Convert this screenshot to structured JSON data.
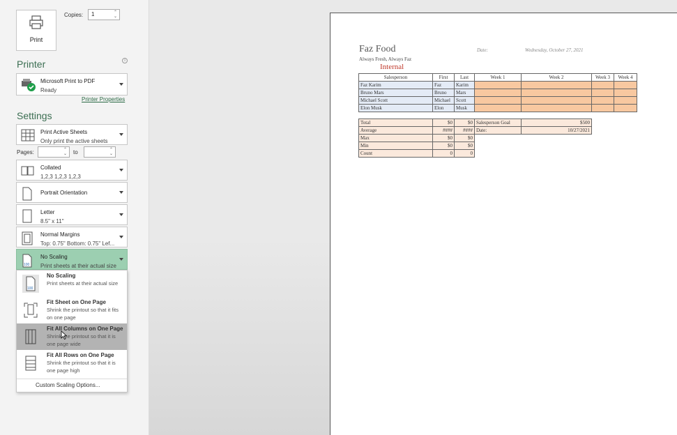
{
  "print_button": {
    "label": "Print"
  },
  "copies": {
    "label": "Copies:",
    "value": "1"
  },
  "printer": {
    "section_title": "Printer",
    "name": "Microsoft Print to PDF",
    "status": "Ready",
    "properties_link": "Printer Properties"
  },
  "settings": {
    "section_title": "Settings",
    "print_what": {
      "title": "Print Active Sheets",
      "subtitle": "Only print the active sheets"
    },
    "pages": {
      "label": "Pages:",
      "from": "",
      "to_label": "to",
      "to": ""
    },
    "collation": {
      "title": "Collated",
      "subtitle": "1,2,3   1,2,3   1,2,3"
    },
    "orientation": {
      "title": "Portrait Orientation"
    },
    "paper": {
      "title": "Letter",
      "subtitle": "8.5\" x 11\""
    },
    "margins": {
      "title": "Normal Margins",
      "subtitle": "Top: 0.75\" Bottom: 0.75\" Lef..."
    },
    "scaling": {
      "title": "No Scaling",
      "subtitle": "Print sheets at their actual size"
    }
  },
  "scaling_menu": {
    "items": [
      {
        "title": "No Scaling",
        "desc": "Print sheets at their actual size",
        "icon_text": "100"
      },
      {
        "title": "Fit Sheet on One Page",
        "desc": "Shrink the printout so that it fits on one page"
      },
      {
        "title": "Fit All Columns on One Page",
        "desc": "Shrink the printout so that it is one page wide"
      },
      {
        "title": "Fit All Rows on One Page",
        "desc": "Shrink the printout so that it is one page high"
      }
    ],
    "custom": "Custom Scaling Options..."
  },
  "preview": {
    "company": "Faz Food",
    "slogan": "Always Fresh, Always Faz",
    "internal": "Internal",
    "date_label": "Date:",
    "date_value": "Wednesday, October 27, 2021",
    "sales_headers": [
      "Salesperson",
      "First",
      "Last",
      "Week 1",
      "Week 2",
      "Week 3",
      "Week 4"
    ],
    "sales_rows": [
      {
        "name": "Faz Karim",
        "first": "Faz",
        "last": "Karim"
      },
      {
        "name": "Bruno Mars",
        "first": "Bruno",
        "last": "Mars"
      },
      {
        "name": "Michael Scott",
        "first": "Michael",
        "last": "Scott"
      },
      {
        "name": "Elon Musk",
        "first": "Elon",
        "last": "Musk"
      }
    ],
    "summary_rows": [
      {
        "label": "Total",
        "a": "$0",
        "b": "$0"
      },
      {
        "label": "Average",
        "a": "####",
        "b": "####"
      },
      {
        "label": "Max",
        "a": "$0",
        "b": "$0"
      },
      {
        "label": "Min",
        "a": "$0",
        "b": "$0"
      },
      {
        "label": "Count",
        "a": "0",
        "b": "0"
      }
    ],
    "goal_label": "Salesperson Goal",
    "goal_value": "$500",
    "goal_date_label": "Date:",
    "goal_date_value": "10/27/2021"
  },
  "colors": {
    "accent": "#3b6e52",
    "selected_dropdown": "#9ccfb1",
    "week_cells": "#f8c8a0",
    "name_cells": "#e4ebf6",
    "internal_text": "#c0392b"
  }
}
